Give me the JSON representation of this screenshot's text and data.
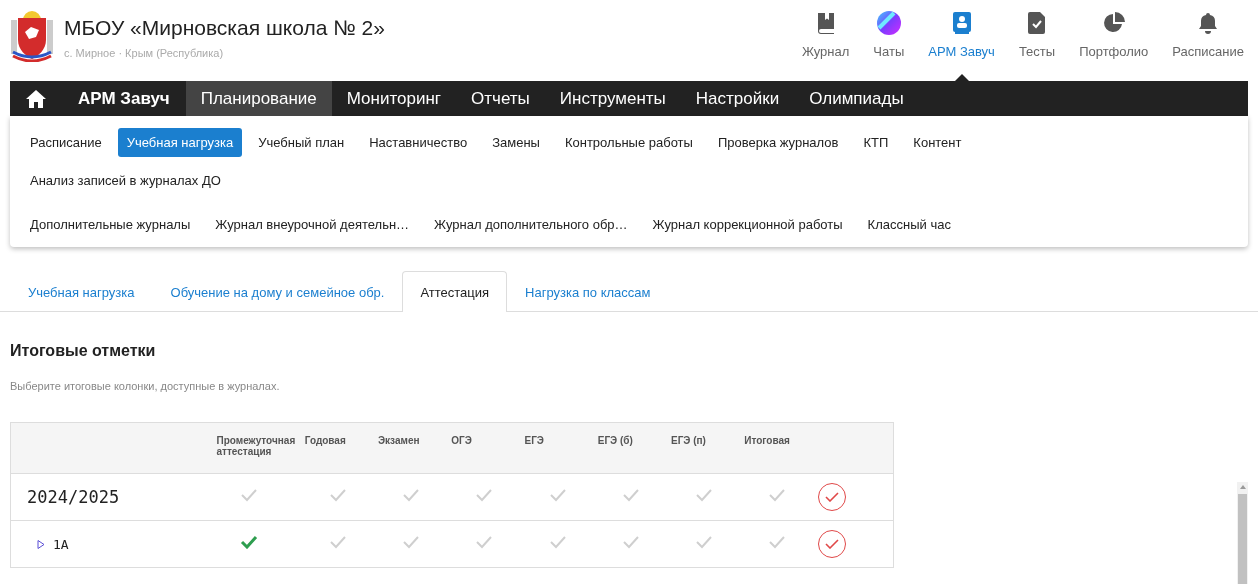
{
  "school": {
    "name": "МБОУ «Мирновская школа № 2»",
    "location": "с. Мирное · Крым (Республика)"
  },
  "apps": [
    {
      "label": "Журнал",
      "selected": false
    },
    {
      "label": "Чаты",
      "selected": false
    },
    {
      "label": "АРМ Завуч",
      "selected": true
    },
    {
      "label": "Тесты",
      "selected": false
    },
    {
      "label": "Портфолио",
      "selected": false
    },
    {
      "label": "Расписание",
      "selected": false
    }
  ],
  "nav": [
    {
      "kind": "home",
      "selected": false
    },
    {
      "kind": "brand",
      "label": "АРМ Завуч",
      "selected": false
    },
    {
      "kind": "item",
      "label": "Планирование",
      "selected": true
    },
    {
      "kind": "item",
      "label": "Мониторинг",
      "selected": false
    },
    {
      "kind": "item",
      "label": "Отчеты",
      "selected": false
    },
    {
      "kind": "item",
      "label": "Инструменты",
      "selected": false
    },
    {
      "kind": "item",
      "label": "Настройки",
      "selected": false
    },
    {
      "kind": "item",
      "label": "Олимпиады",
      "selected": false
    }
  ],
  "submenu": {
    "items": [
      {
        "label": "Расписание",
        "selected": false
      },
      {
        "label": "Учебная нагрузка",
        "selected": true
      },
      {
        "label": "Учебный план",
        "selected": false
      },
      {
        "label": "Наставничество",
        "selected": false
      },
      {
        "label": "Замены",
        "selected": false
      },
      {
        "label": "Контрольные работы",
        "selected": false
      },
      {
        "label": "Проверка журналов",
        "selected": false
      },
      {
        "label": "КТП",
        "selected": false
      },
      {
        "label": "Контент",
        "selected": false
      },
      {
        "label": "Анализ записей в журналах ДО",
        "selected": false
      }
    ],
    "journals": [
      {
        "label": "Дополнительные журналы",
        "selected": false
      },
      {
        "label": "Журнал внеурочной деятельн…",
        "selected": false
      },
      {
        "label": "Журнал дополнительного обр…",
        "selected": false
      },
      {
        "label": "Журнал коррекционной работы",
        "selected": false
      },
      {
        "label": "Классный час",
        "selected": false
      }
    ]
  },
  "tabs": [
    {
      "label": "Учебная нагрузка",
      "selected": false
    },
    {
      "label": "Обучение на дому и семейное обр.",
      "selected": false
    },
    {
      "label": "Аттестация",
      "selected": true
    },
    {
      "label": "Нагрузка по классам",
      "selected": false
    }
  ],
  "section": {
    "title": "Итоговые отметки",
    "hint": "Выберите итоговые колонки, доступные в журналах."
  },
  "table": {
    "columns": [
      "Промежуточная аттестация",
      "Годовая",
      "Экзамен",
      "ОГЭ",
      "ЕГЭ",
      "ЕГЭ (б)",
      "ЕГЭ (п)",
      "Итоговая"
    ],
    "rows": [
      {
        "kind": "year",
        "label": "2024/2025",
        "cells": [
          {
            "checked": false
          },
          {
            "checked": false
          },
          {
            "checked": false
          },
          {
            "checked": false
          },
          {
            "checked": false
          },
          {
            "checked": false
          },
          {
            "checked": false
          },
          {
            "checked": false
          }
        ]
      },
      {
        "kind": "class",
        "label": "1А",
        "expanded": false,
        "cells": [
          {
            "checked": true
          },
          {
            "checked": false
          },
          {
            "checked": false
          },
          {
            "checked": false
          },
          {
            "checked": false
          },
          {
            "checked": false
          },
          {
            "checked": false
          },
          {
            "checked": false
          }
        ]
      }
    ]
  }
}
